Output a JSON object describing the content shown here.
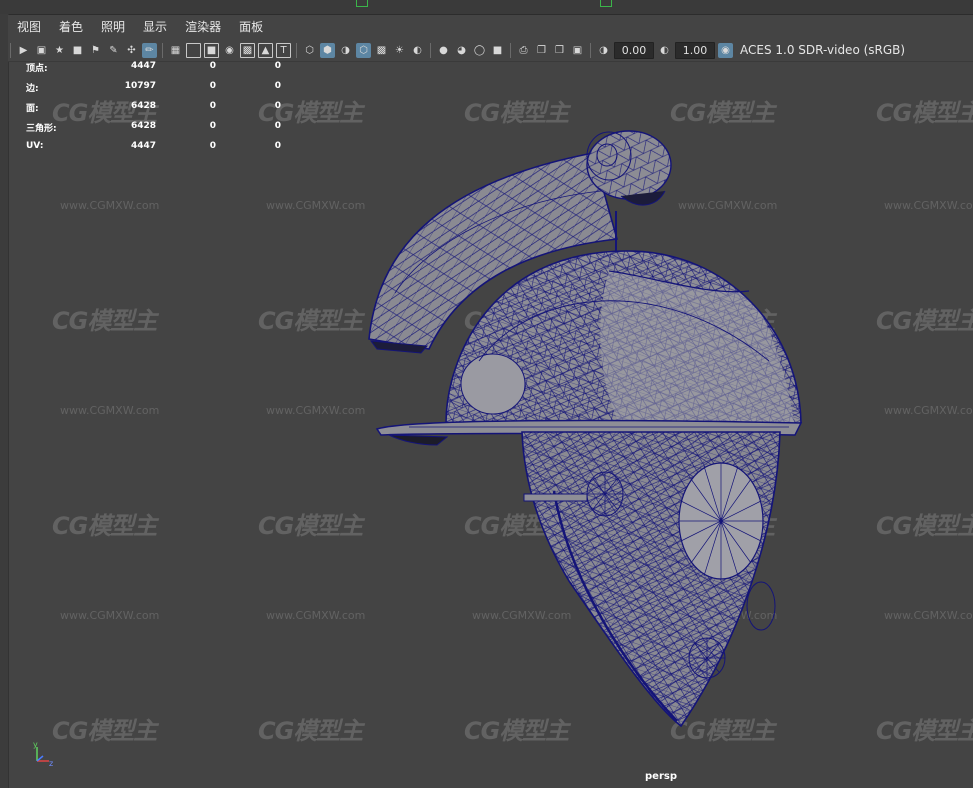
{
  "menubar": {
    "items": [
      "视图",
      "着色",
      "照明",
      "显示",
      "渲染器",
      "面板"
    ]
  },
  "toolbar": {
    "exposure_value": "0.00",
    "gamma_value": "1.00",
    "color_space": "ACES 1.0 SDR-video (sRGB)",
    "accent_color": "#5d86a3"
  },
  "hud": {
    "rows": [
      {
        "label": "顶点:",
        "values": [
          "4447",
          "0",
          "0"
        ]
      },
      {
        "label": "边:",
        "values": [
          "10797",
          "0",
          "0"
        ]
      },
      {
        "label": "面:",
        "values": [
          "6428",
          "0",
          "0"
        ]
      },
      {
        "label": "三角形:",
        "values": [
          "6428",
          "0",
          "0"
        ]
      },
      {
        "label": "UV:",
        "values": [
          "4447",
          "0",
          "0"
        ]
      }
    ]
  },
  "viewport": {
    "camera_label": "persp",
    "background_color": "#444444",
    "wire_color": "#1a1a7a",
    "axis_labels": {
      "x": "x",
      "y": "y",
      "z": "z"
    }
  },
  "watermark": {
    "logo_text": "CG模型主",
    "url_text": "www.CGMXW.com"
  }
}
